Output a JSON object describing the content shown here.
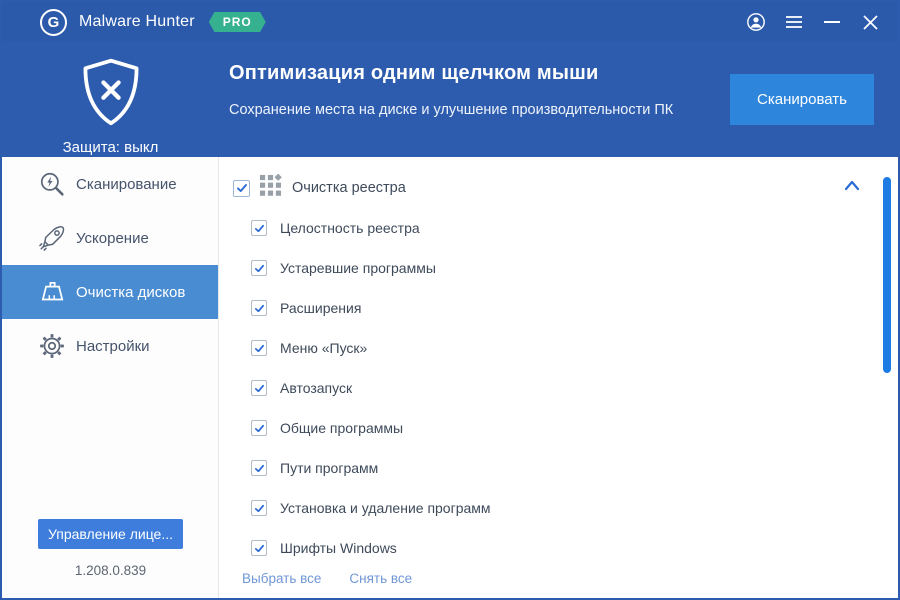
{
  "colors": {
    "titlebar_blue": "#2b5aab",
    "header_blue": "#2d5cae",
    "scan_button_blue": "#2e86dc",
    "selected_item_blue": "#4a8cd2",
    "license_button_blue": "#3e7ddb",
    "pro_badge_teal": "#35b18f",
    "checkmark_blue": "#2b6cd4",
    "scrollbar_blue": "#1d7ce4",
    "link_blue": "#7097d6"
  },
  "titlebar": {
    "app_name": "Malware Hunter",
    "pro_badge": "PRO",
    "logo_letter": "G"
  },
  "header": {
    "shield_status": "Защита: выкл",
    "title": "Оптимизация одним щелчком мыши",
    "subtitle": "Сохранение места на диске и улучшение производительности ПК",
    "scan_button": "Сканировать"
  },
  "sidebar": {
    "items": [
      {
        "label": "Сканирование",
        "icon": "scan-magnifier-icon",
        "selected": false
      },
      {
        "label": "Ускорение",
        "icon": "rocket-icon",
        "selected": false
      },
      {
        "label": "Очистка дисков",
        "icon": "broom-icon",
        "selected": true
      },
      {
        "label": "Настройки",
        "icon": "gear-icon",
        "selected": false
      }
    ],
    "license_button": "Управление лице...",
    "version": "1.208.0.839"
  },
  "main": {
    "group_label": "Очистка реестра",
    "group_checked": true,
    "group_expanded": true,
    "items": [
      {
        "label": "Целостность реестра",
        "checked": true
      },
      {
        "label": "Устаревшие программы",
        "checked": true
      },
      {
        "label": "Расширения",
        "checked": true
      },
      {
        "label": "Меню «Пуск»",
        "checked": true
      },
      {
        "label": "Автозапуск",
        "checked": true
      },
      {
        "label": "Общие программы",
        "checked": true
      },
      {
        "label": "Пути программ",
        "checked": true
      },
      {
        "label": "Установка и удаление программ",
        "checked": true
      },
      {
        "label": "Шрифты Windows",
        "checked": true
      }
    ],
    "select_all": "Выбрать все",
    "deselect_all": "Снять все"
  }
}
